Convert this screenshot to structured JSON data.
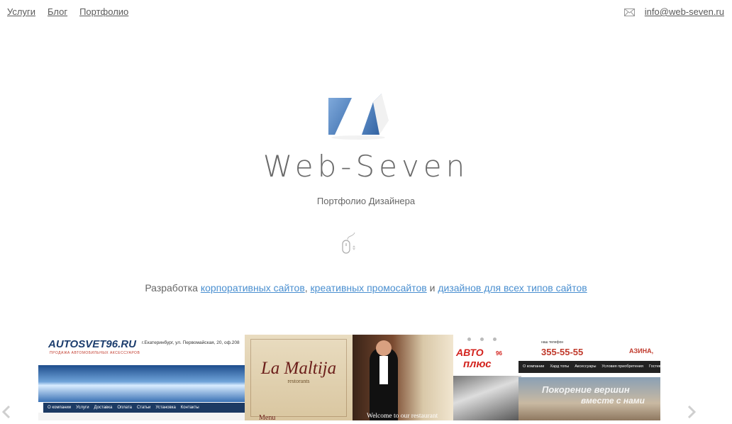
{
  "nav": {
    "items": [
      "Услуги",
      "Блог",
      "Портфолио"
    ]
  },
  "contact": {
    "email": "info@web-seven.ru",
    "icon": "mail-icon"
  },
  "hero": {
    "brand": "Web-Seven",
    "tagline": "Портфолио Дизайнера",
    "scroll_icon": "mouse-icon"
  },
  "development": {
    "prefix": "Разработка",
    "link1": "корпоративных сайтов",
    "sep1": ",",
    "link2": "креативных промосайтов",
    "conj": "и",
    "link3": "дизайнов для всех типов сайтов"
  },
  "carousel": {
    "slide1": {
      "title": "AUTOSVET96.RU",
      "subtitle": "ПРОДАЖА АВТОМОБИЛЬНЫХ АКСЕССУАРОВ",
      "address": "г.Екатеринбург, ул. Первомайская, 20, оф.208",
      "nav": [
        "О компании",
        "Услуги",
        "Доставка",
        "Оплата",
        "Статьи",
        "Установка",
        "Контакты"
      ]
    },
    "slide2": {
      "title": "La Maltija",
      "subtitle": "restorants",
      "menu": "Menu"
    },
    "slide3": {
      "welcome": "Welcome to our restaurant"
    },
    "slide4": {
      "logo_line1": "АВТО",
      "logo_line2": "плюс",
      "logo_num": "96",
      "phone_label": "наш телефон",
      "phone": "355-55-55",
      "city": "АЗИНА,",
      "nav": [
        "О компании",
        "Хард топы",
        "Аксессуары",
        "Условия приобретения",
        "Гостевая"
      ],
      "banner_line1": "Покорение вершин",
      "banner_line2": "вместе с нами"
    },
    "prev_icon": "chevron-left-icon",
    "next_icon": "chevron-right-icon"
  },
  "colors": {
    "link": "#4a8fd0",
    "text": "#555555",
    "logo_blue": "#4f86c6"
  }
}
